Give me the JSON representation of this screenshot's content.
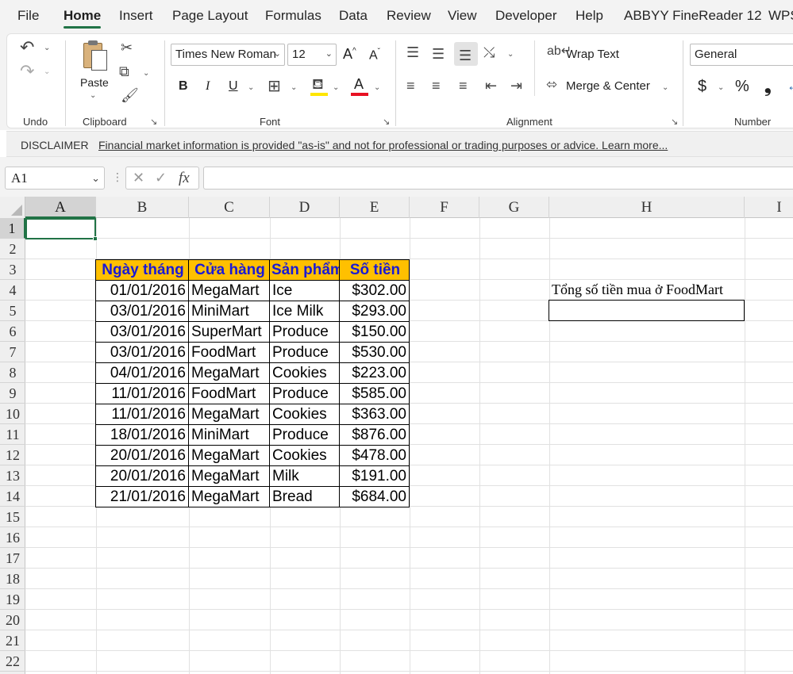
{
  "menu": {
    "tabs": [
      "File",
      "Home",
      "Insert",
      "Page Layout",
      "Formulas",
      "Data",
      "Review",
      "View",
      "Developer",
      "Help",
      "ABBYY FineReader 12",
      "WPS"
    ],
    "active": "Home"
  },
  "ribbon": {
    "groups": {
      "undo": "Undo",
      "clipboard": "Clipboard",
      "font": "Font",
      "alignment": "Alignment",
      "number": "Number"
    },
    "paste_label": "Paste",
    "font_name": "Times New Roman",
    "font_size": "12",
    "wrap_text": "Wrap Text",
    "merge_center": "Merge & Center",
    "number_format": "General",
    "bold": "B",
    "italic": "I",
    "underline": "U",
    "currency": "$",
    "percent": "%",
    "comma": "❟",
    "grow_font": "A",
    "shrink_font": "A",
    "fill_color": "#FFE600",
    "font_color": "#E81123",
    "accent": "#217346"
  },
  "disclaimer": {
    "title": "DISCLAIMER",
    "text": "Financial market information is provided \"as-is\" and not for professional or trading purposes or advice. Learn more..."
  },
  "formula_bar": {
    "name_box": "A1",
    "fx": "fx",
    "value": ""
  },
  "grid": {
    "columns": [
      "A",
      "B",
      "C",
      "D",
      "E",
      "F",
      "G",
      "H",
      "I"
    ],
    "rows": [
      "1",
      "2",
      "3",
      "4",
      "5",
      "6",
      "7",
      "8",
      "9",
      "10",
      "11",
      "12",
      "13",
      "14",
      "15",
      "16",
      "17",
      "18",
      "19",
      "20",
      "21",
      "22"
    ],
    "selected_column": "A",
    "selected_row": "1"
  },
  "table": {
    "header_color": "#FFC000",
    "header_text_color": "#1A1AD6",
    "headers": [
      "Ngày tháng",
      "Cửa hàng",
      "Sản phẩm",
      "Số tiền"
    ],
    "rows": [
      [
        "01/01/2016",
        "MegaMart",
        "Ice",
        "$302.00"
      ],
      [
        "03/01/2016",
        "MiniMart",
        "Ice Milk",
        "$293.00"
      ],
      [
        "03/01/2016",
        "SuperMart",
        "Produce",
        "$150.00"
      ],
      [
        "03/01/2016",
        "FoodMart",
        "Produce",
        "$530.00"
      ],
      [
        "04/01/2016",
        "MegaMart",
        "Cookies",
        "$223.00"
      ],
      [
        "11/01/2016",
        "FoodMart",
        "Produce",
        "$585.00"
      ],
      [
        "11/01/2016",
        "MegaMart",
        "Cookies",
        "$363.00"
      ],
      [
        "18/01/2016",
        "MiniMart",
        "Produce",
        "$876.00"
      ],
      [
        "20/01/2016",
        "MegaMart",
        "Cookies",
        "$478.00"
      ],
      [
        "20/01/2016",
        "MegaMart",
        "Milk",
        "$191.00"
      ],
      [
        "21/01/2016",
        "MegaMart",
        "Bread",
        "$684.00"
      ]
    ]
  },
  "summary": {
    "label": "Tổng số tiền mua ở FoodMart",
    "value": ""
  }
}
